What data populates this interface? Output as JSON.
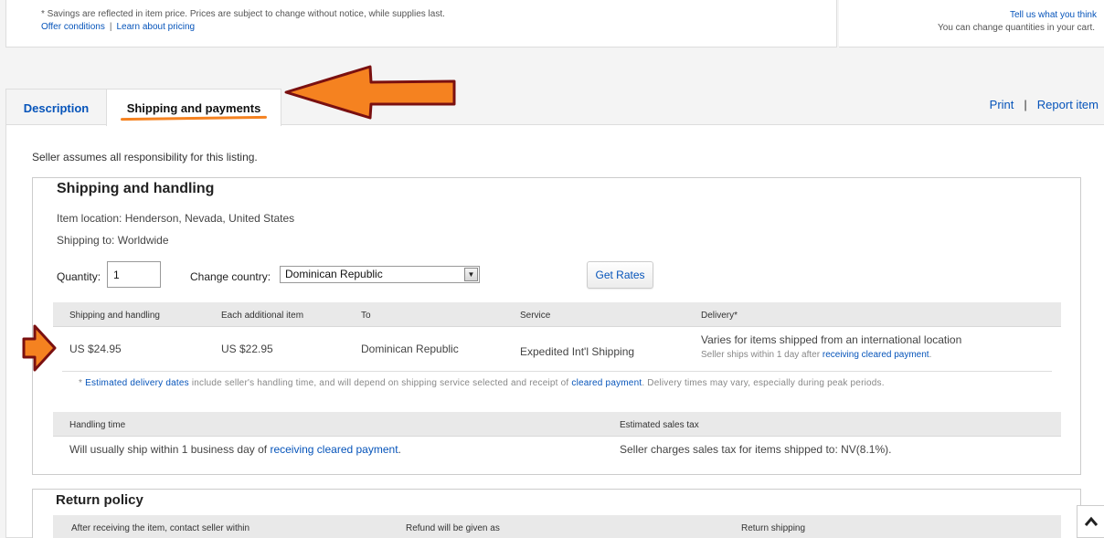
{
  "top": {
    "savings_note": "* Savings are reflected in item price. Prices are subject to change without notice, while supplies last.",
    "offer_conditions": "Offer conditions",
    "separator": "|",
    "learn_pricing": "Learn about pricing",
    "feedback": "Tell us what you think",
    "cart_note": "You can change quantities in your cart."
  },
  "tabs": {
    "description": "Description",
    "shipping": "Shipping and payments"
  },
  "actions": {
    "print": "Print",
    "separator": "|",
    "report": "Report item"
  },
  "content": {
    "seller_note": "Seller assumes all responsibility for this listing."
  },
  "shipping": {
    "title": "Shipping and handling",
    "item_location": "Item location: Henderson, Nevada, United States",
    "shipping_to": "Shipping to: Worldwide",
    "quantity_label": "Quantity:",
    "quantity_value": "1",
    "country_label": "Change country:",
    "country_value": "Dominican Republic",
    "get_rates": "Get Rates",
    "headers": [
      "Shipping and handling",
      "Each additional item",
      "To",
      "Service",
      "Delivery*"
    ],
    "row": {
      "cost": "US $24.95",
      "additional": "US $22.95",
      "to": "Dominican Republic",
      "service": "Expedited Int'l Shipping",
      "delivery": "Varies for items shipped from an international location",
      "delivery_sub_prefix": "Seller ships within 1 day after",
      "delivery_sub_link": "receiving cleared payment",
      "delivery_sub_suffix": "."
    },
    "note_prefix": "*",
    "note_link1": "Estimated delivery dates",
    "note_mid": "include seller's handling time, and will depend on shipping service selected and receipt of",
    "note_link2": "cleared payment",
    "note_suffix": ". Delivery times may vary, especially during peak periods.",
    "handling_header": "Handling time",
    "tax_header": "Estimated sales tax",
    "handling_prefix": "Will usually ship within 1 business day of",
    "handling_link": "receiving cleared payment",
    "handling_suffix": ".",
    "tax_text": "Seller charges sales tax for items shipped to: NV(8.1%)."
  },
  "returns": {
    "title": "Return policy",
    "headers": [
      "After receiving the item, contact seller within",
      "Refund will be given as",
      "Return shipping"
    ]
  },
  "colors": {
    "link": "#0654ba",
    "annotation_arrow_fill": "#f58220",
    "annotation_arrow_stroke": "#7a1010"
  },
  "icons": {
    "scroll_top": "chevron-up-icon",
    "dropdown": "triangle-down-icon"
  }
}
